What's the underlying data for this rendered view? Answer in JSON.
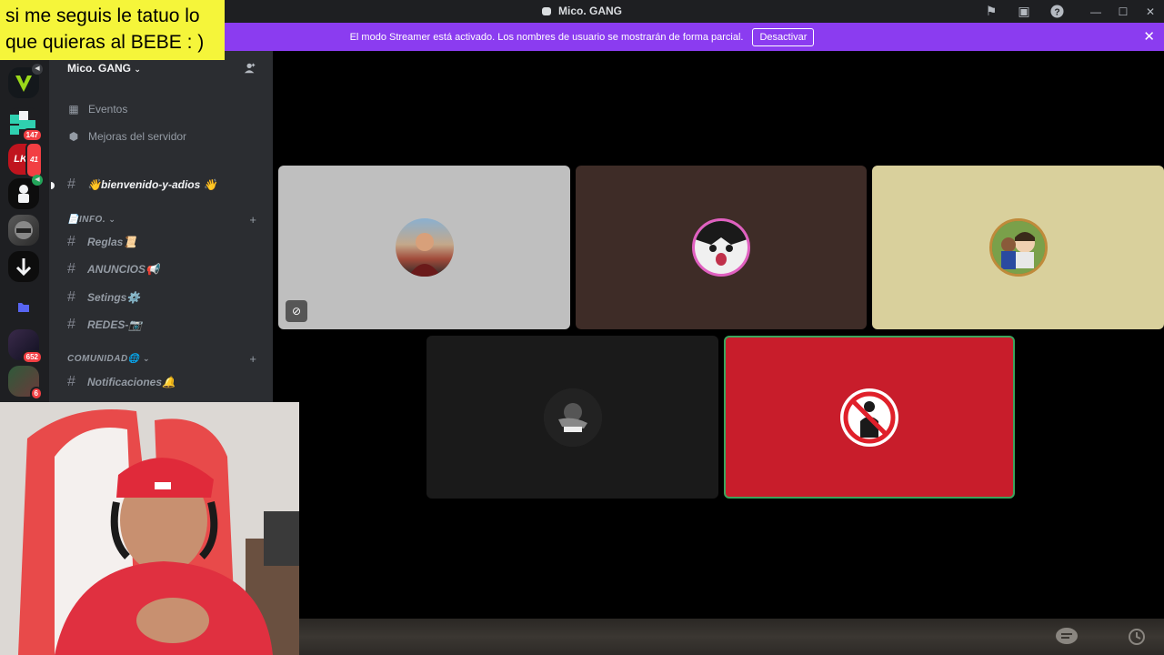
{
  "window": {
    "title": "Mico. GANG",
    "icons": [
      "flag-icon",
      "inbox-icon",
      "help-icon",
      "minimize-icon",
      "maximize-icon",
      "close-icon"
    ]
  },
  "banner": {
    "message": "El modo Streamer está activado. Los nombres de usuario se mostrarán de forma parcial.",
    "button_label": "Desactivar",
    "close_glyph": "✕",
    "color": "#8b3cf0"
  },
  "overlay_text": "si me seguis le tatuo lo que quieras al BEBE : )",
  "servers": [
    {
      "name": "server-v",
      "badge": ""
    },
    {
      "name": "server-blocks",
      "badge": "147"
    },
    {
      "name": "server-lkz",
      "badge": "41",
      "label": "LKZ"
    },
    {
      "name": "server-figure",
      "badge": ""
    },
    {
      "name": "server-helmet",
      "badge": ""
    },
    {
      "name": "server-arrow",
      "badge": ""
    },
    {
      "name": "server-folder",
      "badge": ""
    },
    {
      "name": "server-dark",
      "badge": "652"
    },
    {
      "name": "server-char",
      "badge": "6"
    }
  ],
  "sidebar": {
    "server_name": "Mico. GANG",
    "nav": [
      {
        "label": "Eventos",
        "icon": "calendar-icon"
      },
      {
        "label": "Mejoras del servidor",
        "icon": "boost-icon"
      }
    ],
    "welcome_channel": "👋bienvenido-y-adios 👋",
    "categories": [
      {
        "name": "📄INFO.",
        "channels": [
          "Reglas📜",
          "ANUNCIOS📢",
          "Setings⚙️",
          "REDES-📷"
        ]
      },
      {
        "name": "COMUNIDAD🌐",
        "channels": [
          "Notificaciones🔔"
        ]
      }
    ]
  },
  "tiles": [
    {
      "name": "participant-1",
      "bg": "#bfbfbf",
      "avatar": "man-outdoors",
      "camera_off": true,
      "speaking": false
    },
    {
      "name": "participant-2",
      "bg": "#3e2c27",
      "avatar": "cat-face",
      "camera_off": false,
      "speaking": false
    },
    {
      "name": "participant-3",
      "bg": "#d9d09c",
      "avatar": "cartoon-kids",
      "camera_off": false,
      "speaking": false
    },
    {
      "name": "participant-4",
      "bg": "#1a1a1a",
      "avatar": "dark-logo",
      "camera_off": false,
      "speaking": false
    },
    {
      "name": "participant-5",
      "bg": "#c81d2b",
      "avatar": "no-entry-figure",
      "camera_off": false,
      "speaking": true
    }
  ]
}
